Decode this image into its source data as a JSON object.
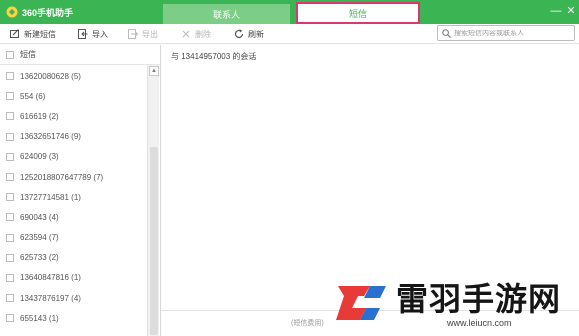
{
  "window": {
    "app_title": "360手机助手",
    "min_glyph": "—",
    "close_glyph": "✕",
    "accent": "#3bb454",
    "highlight_border": "#d9396f"
  },
  "tabs": [
    {
      "label": "联系人",
      "active": false
    },
    {
      "label": "短信",
      "active": true
    }
  ],
  "toolbar": {
    "new_sms": {
      "label": "新建短信",
      "icon": "compose-icon"
    },
    "import": {
      "label": "导入",
      "icon": "import-icon"
    },
    "export": {
      "label": "导出",
      "icon": "export-icon",
      "disabled": true
    },
    "delete": {
      "label": "删除",
      "icon": "delete-icon",
      "disabled": true
    },
    "refresh": {
      "label": "刷新",
      "icon": "refresh-icon"
    }
  },
  "search": {
    "placeholder": "搜索短信内容或联系人",
    "value": ""
  },
  "list": {
    "header": "短信",
    "items": [
      "13620080628 (5)",
      "554 (6)",
      "616619 (2)",
      "13632651746 (9)",
      "624009 (3)",
      "1252018807647789 (7)",
      "13727714581 (1)",
      "690043 (4)",
      "623594 (7)",
      "625733 (2)",
      "13640847816 (1)",
      "13437876197 (4)",
      "655143 (1)"
    ]
  },
  "conversation": {
    "title": "与 13414957003 的会话",
    "footer": "(短信费用)"
  },
  "watermark": {
    "brand": "雷羽手游网",
    "url": "www.leiucn.com",
    "colors": {
      "red": "#e83a36",
      "blue": "#2b6fd1"
    }
  }
}
